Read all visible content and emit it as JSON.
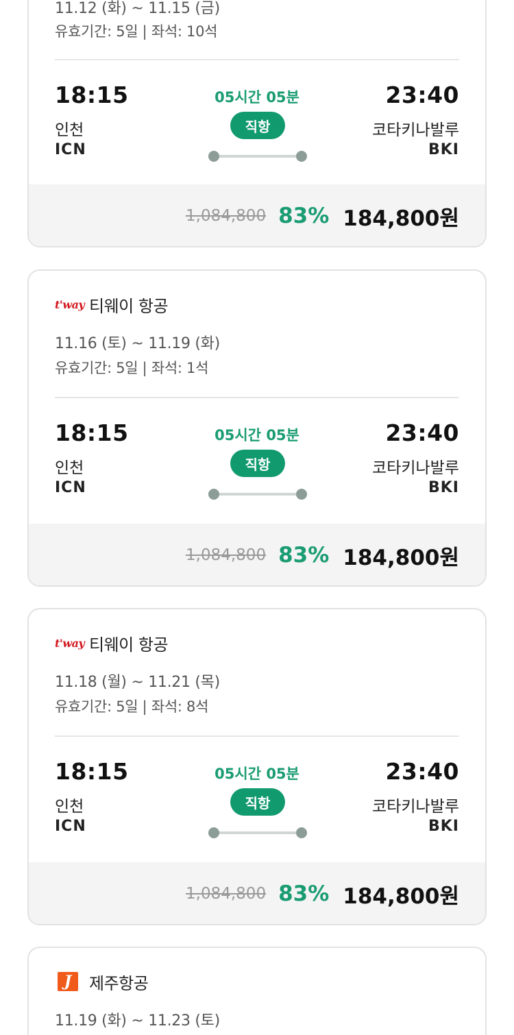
{
  "flight_common": {
    "dep_time": "18:15",
    "dep_city": "인천",
    "dep_code": "ICN",
    "arr_time": "23:40",
    "arr_city": "코타키나발루",
    "arr_code": "BKI",
    "duration": "05시간 05분",
    "badge": "직항",
    "orig_price": "1,084,800",
    "discount": "83%",
    "price": "184,800원"
  },
  "cards": [
    {
      "airline": "",
      "dates": "11.12 (화) ~ 11.15 (금)",
      "validity": "유효기간: 5일 | 좌석: 10석"
    },
    {
      "airline": "티웨이 항공",
      "logo": "t'way",
      "dates": "11.16 (토) ~ 11.19 (화)",
      "validity": "유효기간: 5일 | 좌석: 1석"
    },
    {
      "airline": "티웨이 항공",
      "logo": "t'way",
      "dates": "11.18 (월) ~ 11.21 (목)",
      "validity": "유효기간: 5일 | 좌석: 8석"
    },
    {
      "airline": "제주항공",
      "logo": "J",
      "dates": "11.19 (화) ~ 11.23 (토)",
      "validity": ""
    }
  ],
  "colors": {
    "accent": "#1a9c72",
    "badge_bg": "#119a6e",
    "tway_logo": "#d31920",
    "jeju_logo": "#f05a1a"
  },
  "icons": {
    "tway": "tway-logo-icon",
    "jeju": "jejuair-logo-icon"
  }
}
